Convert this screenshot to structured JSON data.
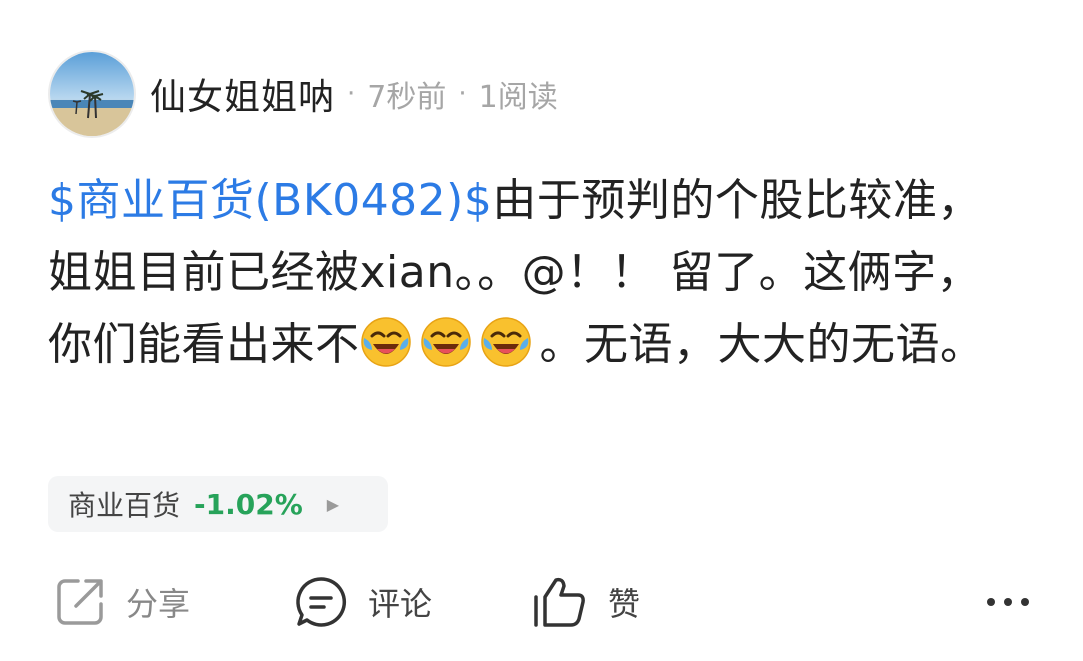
{
  "post": {
    "author": "仙女姐姐呐",
    "time": "7秒前",
    "reads": "1阅读",
    "stock_tag": "$商业百货(BK0482)$",
    "text_1": "由于预判的个股比较准，姐姐目前已经被xian。。@！！ 留了。这俩字，你们能看出来不",
    "text_2": "。无语，大大的无语。",
    "emoji_name": "laughing-crying-emoji"
  },
  "stock_chip": {
    "name": "商业百货",
    "change": "-1.02%",
    "change_color": "#27a35a"
  },
  "actions": {
    "share": "分享",
    "comment": "评论",
    "like": "赞"
  },
  "colors": {
    "link": "#2c7be5",
    "muted": "#a6a6a6"
  }
}
